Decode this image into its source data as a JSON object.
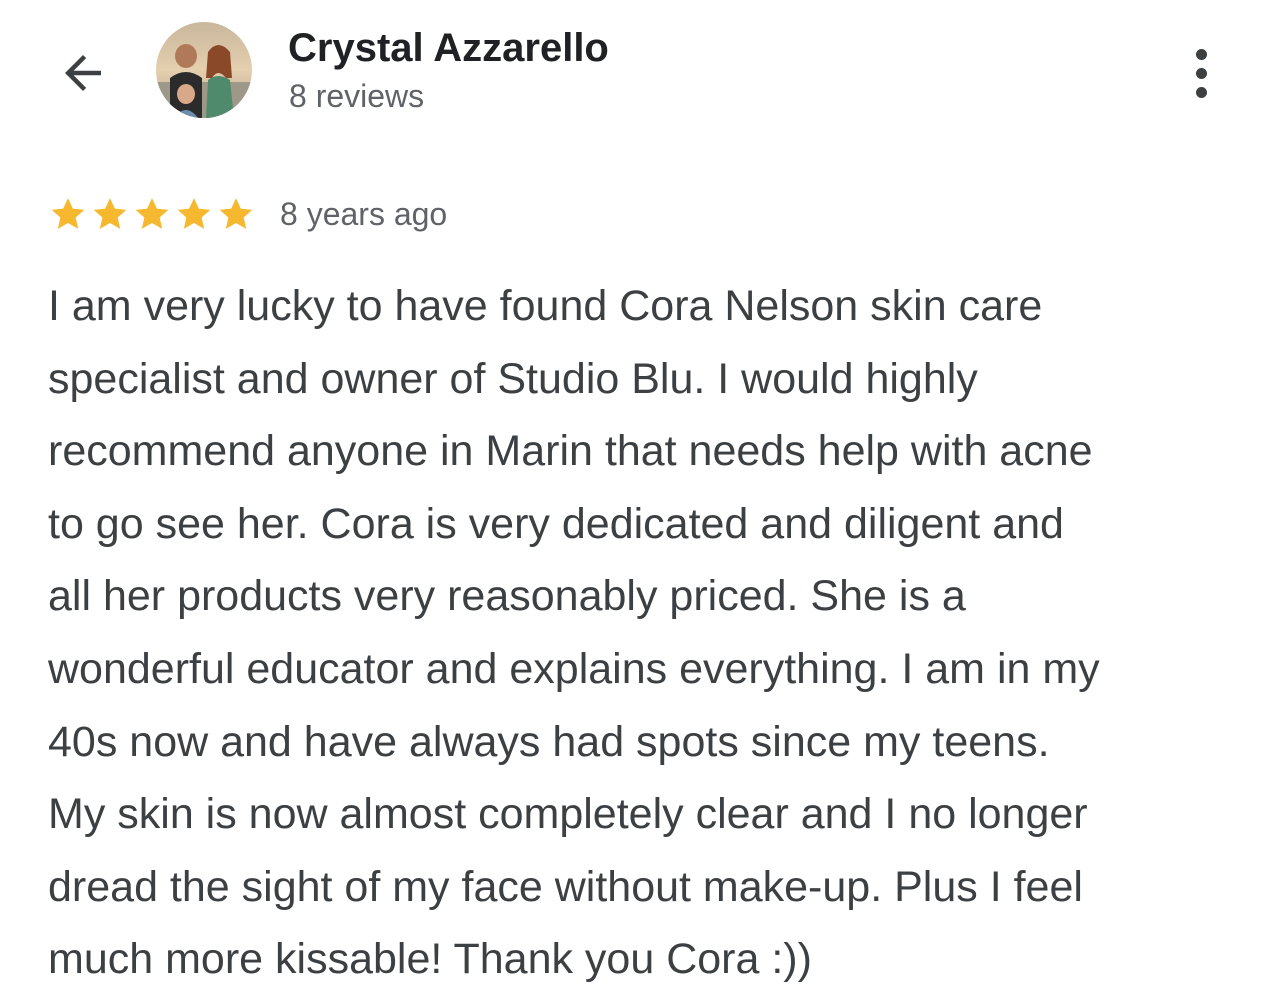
{
  "header": {
    "back_icon": "arrow-left-icon",
    "avatar_icon": "profile-photo",
    "reviewer_name": "Crystal Azzarello",
    "review_count": "8 reviews",
    "more_icon": "more-vertical-icon"
  },
  "review": {
    "rating": 5,
    "rating_max": 5,
    "star_color": "#f5b82e",
    "date": "8 years ago",
    "lines": [
      "I am very lucky to have found Cora Nelson skin care",
      "specialist and owner of Studio Blu. I would highly",
      "recommend anyone in Marin that needs help with acne",
      "to go see her. Cora is very dedicated and diligent and",
      "all her products very reasonably priced. She is a",
      "wonderful educator and explains everything. I am in my",
      "40s now and have always had spots since my teens.",
      "My skin is now almost completely clear and I no longer",
      "dread the sight of my face without make-up. Plus I feel",
      "much more kissable! Thank you Cora :))"
    ]
  }
}
